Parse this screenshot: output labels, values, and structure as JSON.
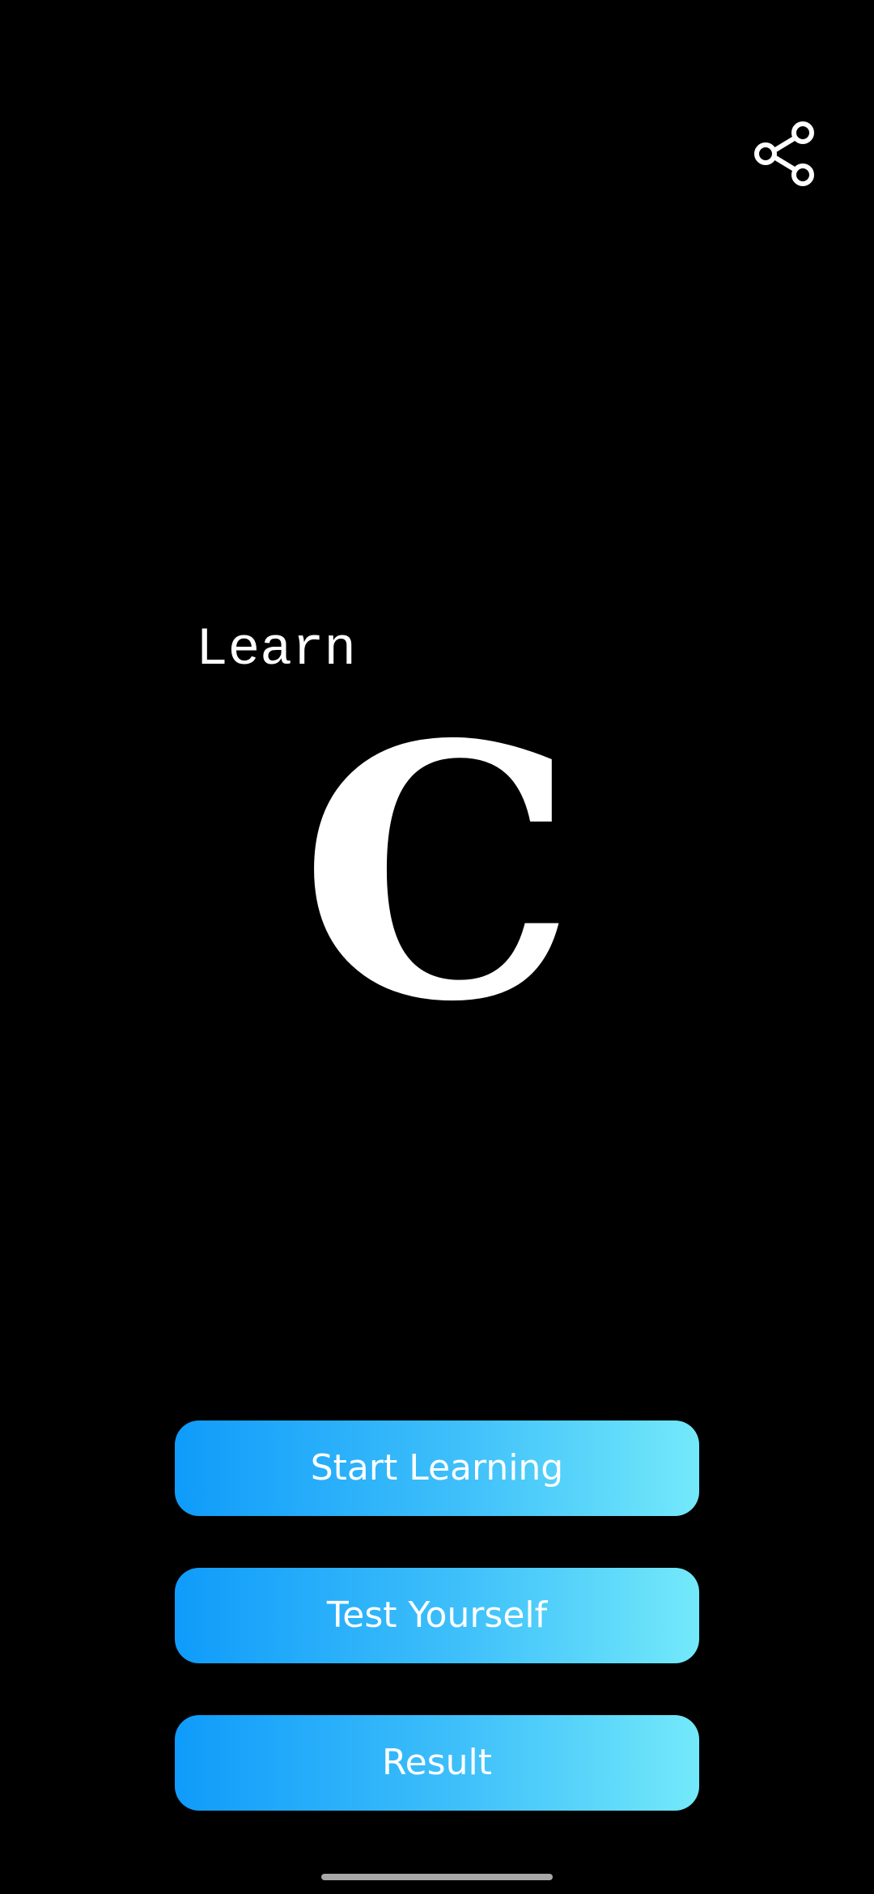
{
  "header": {
    "share_icon": "share-icon"
  },
  "hero": {
    "learn_label": "Learn",
    "logo_letter": "C"
  },
  "actions": {
    "start_learning": "Start Learning",
    "test_yourself": "Test Yourself",
    "result": "Result"
  },
  "colors": {
    "background": "#000000",
    "button_gradient_start": "#0f9bfa",
    "button_gradient_end": "#73e9fa",
    "text": "#ffffff"
  }
}
